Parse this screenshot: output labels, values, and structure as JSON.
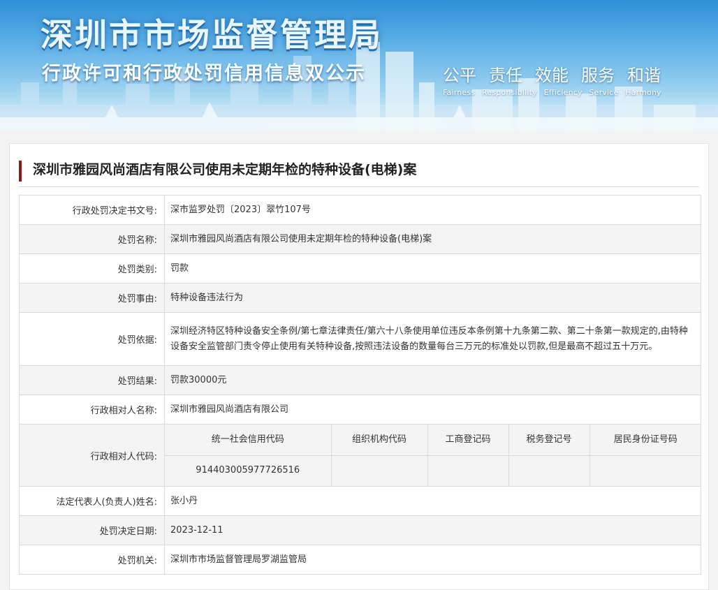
{
  "banner": {
    "title": "深圳市市场监督管理局",
    "subtitle": "行政许可和行政处罚信用信息双公示",
    "slogans": [
      "公平",
      "责任",
      "效能",
      "服务",
      "和谐"
    ],
    "slogans_en": [
      "Fairness",
      "Responsibility",
      "Efficiency",
      "Service",
      "Harmony"
    ]
  },
  "case": {
    "title": "深圳市雅园风尚酒店有限公司使用未定期年检的特种设备(电梯)案"
  },
  "fields": {
    "decision_no": {
      "label": "行政处罚决定书文号:",
      "value": "深市监罗处罚〔2023〕翠竹107号"
    },
    "penalty_name": {
      "label": "处罚名称:",
      "value": "深圳市雅园风尚酒店有限公司使用未定期年检的特种设备(电梯)案"
    },
    "penalty_type": {
      "label": "处罚类别:",
      "value": "罚款"
    },
    "penalty_reason": {
      "label": "处罚事由:",
      "value": "特种设备违法行为"
    },
    "penalty_basis": {
      "label": "处罚依据:",
      "value": "深圳经济特区特种设备安全条例/第七章法律责任/第六十八条使用单位违反本条例第十九条第二款、第二十条第一款规定的,由特种设备安全监管部门责令停止使用有关特种设备,按照违法设备的数量每台三万元的标准处以罚款,但是最高不超过五十万元。"
    },
    "penalty_result": {
      "label": "处罚结果:",
      "value": "罚款30000元"
    },
    "party_name": {
      "label": "行政相对人名称:",
      "value": "深圳市雅园风尚酒店有限公司"
    },
    "party_code": {
      "label": "行政相对人代码:",
      "headers": [
        "统一社会信用代码",
        "组织机构代码",
        "工商登记码",
        "税务登记号",
        "居民身份证号码"
      ],
      "values": [
        "914403005977726516",
        "",
        "",
        "",
        ""
      ]
    },
    "legal_rep": {
      "label": "法定代表人(负责人)姓名:",
      "value": "张小丹"
    },
    "decision_date": {
      "label": "处罚决定日期:",
      "value": "2023-12-11"
    },
    "authority": {
      "label": "处罚机关:",
      "value": "深圳市市场监督管理局罗湖监管局"
    }
  }
}
